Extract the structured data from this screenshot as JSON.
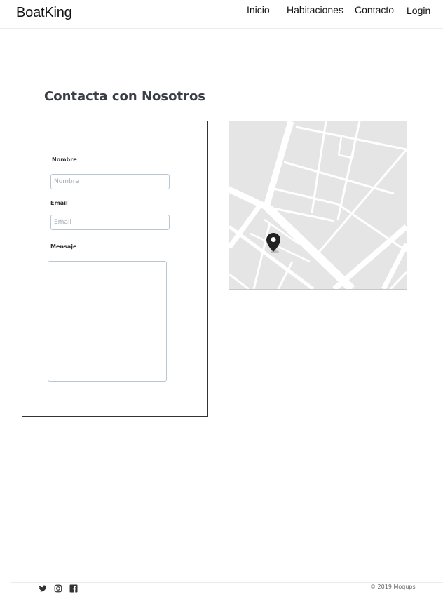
{
  "header": {
    "brand": "BoatKing",
    "nav": [
      {
        "label": "Inicio"
      },
      {
        "label": "Habitaciones"
      },
      {
        "label": "Contacto"
      },
      {
        "label": "Login"
      }
    ]
  },
  "main": {
    "title": "Contacta con Nosotros",
    "form": {
      "name_label": "Nombre",
      "name_placeholder": "Nombre",
      "email_label": "Email",
      "email_placeholder": "Email",
      "message_label": "Mensaje",
      "message_value": ""
    },
    "map": {
      "marker_icon": "map-pin-icon",
      "background_color": "#e5e5e5",
      "road_color": "#ffffff"
    }
  },
  "footer": {
    "social": [
      {
        "icon": "twitter-icon"
      },
      {
        "icon": "instagram-icon"
      },
      {
        "icon": "facebook-icon"
      }
    ],
    "copyright": "© 2019 Moqups"
  }
}
